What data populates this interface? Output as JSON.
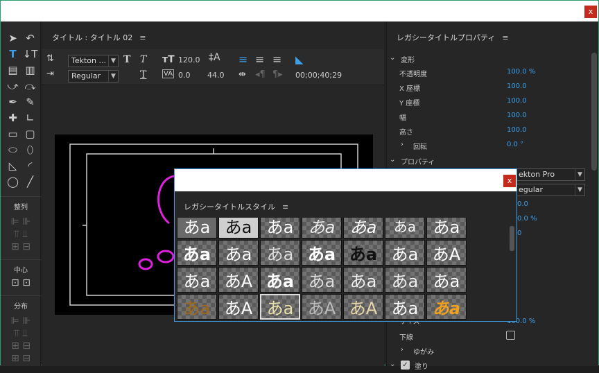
{
  "window": {
    "close_label": "x"
  },
  "toolbar": {
    "section_align": "整列",
    "section_center": "中心",
    "section_distribute": "分布"
  },
  "editor": {
    "title": "タイトル : タイトル 02",
    "font_family": "Tekton ...",
    "font_style": "Regular",
    "font_size": "120.0",
    "leading_value": "0.0",
    "kerning_value": "0.0",
    "tracking_value": "44.0",
    "timecode": "00;00;40;29"
  },
  "legacy_props": {
    "title": "レガシータイトルプロパティ",
    "transform_heading": "変形",
    "rows": [
      {
        "label": "不透明度",
        "value": "100.0 %"
      },
      {
        "label": "X 座標",
        "value": "100.0"
      },
      {
        "label": "Y 座標",
        "value": "100.0"
      },
      {
        "label": "幅",
        "value": "100.0"
      },
      {
        "label": "高さ",
        "value": "100.0"
      },
      {
        "label": "回転",
        "value": "0.0 °"
      }
    ],
    "properties_heading": "プロパティ",
    "font_family_partial": "ekton Pro",
    "font_style_partial": "egular",
    "partial_values": [
      "0.0",
      "0.0 %",
      "0",
      "100.0 %"
    ],
    "size_label_partial": "サイズ",
    "underline_label": "下線",
    "distort_label": "ゆがみ",
    "fill_label_partial": "塗り"
  },
  "style_dialog": {
    "title": "レガシータイトルスタイル",
    "close_label": "x",
    "sample_text": "あa",
    "sample_text_alt": "あA"
  }
}
